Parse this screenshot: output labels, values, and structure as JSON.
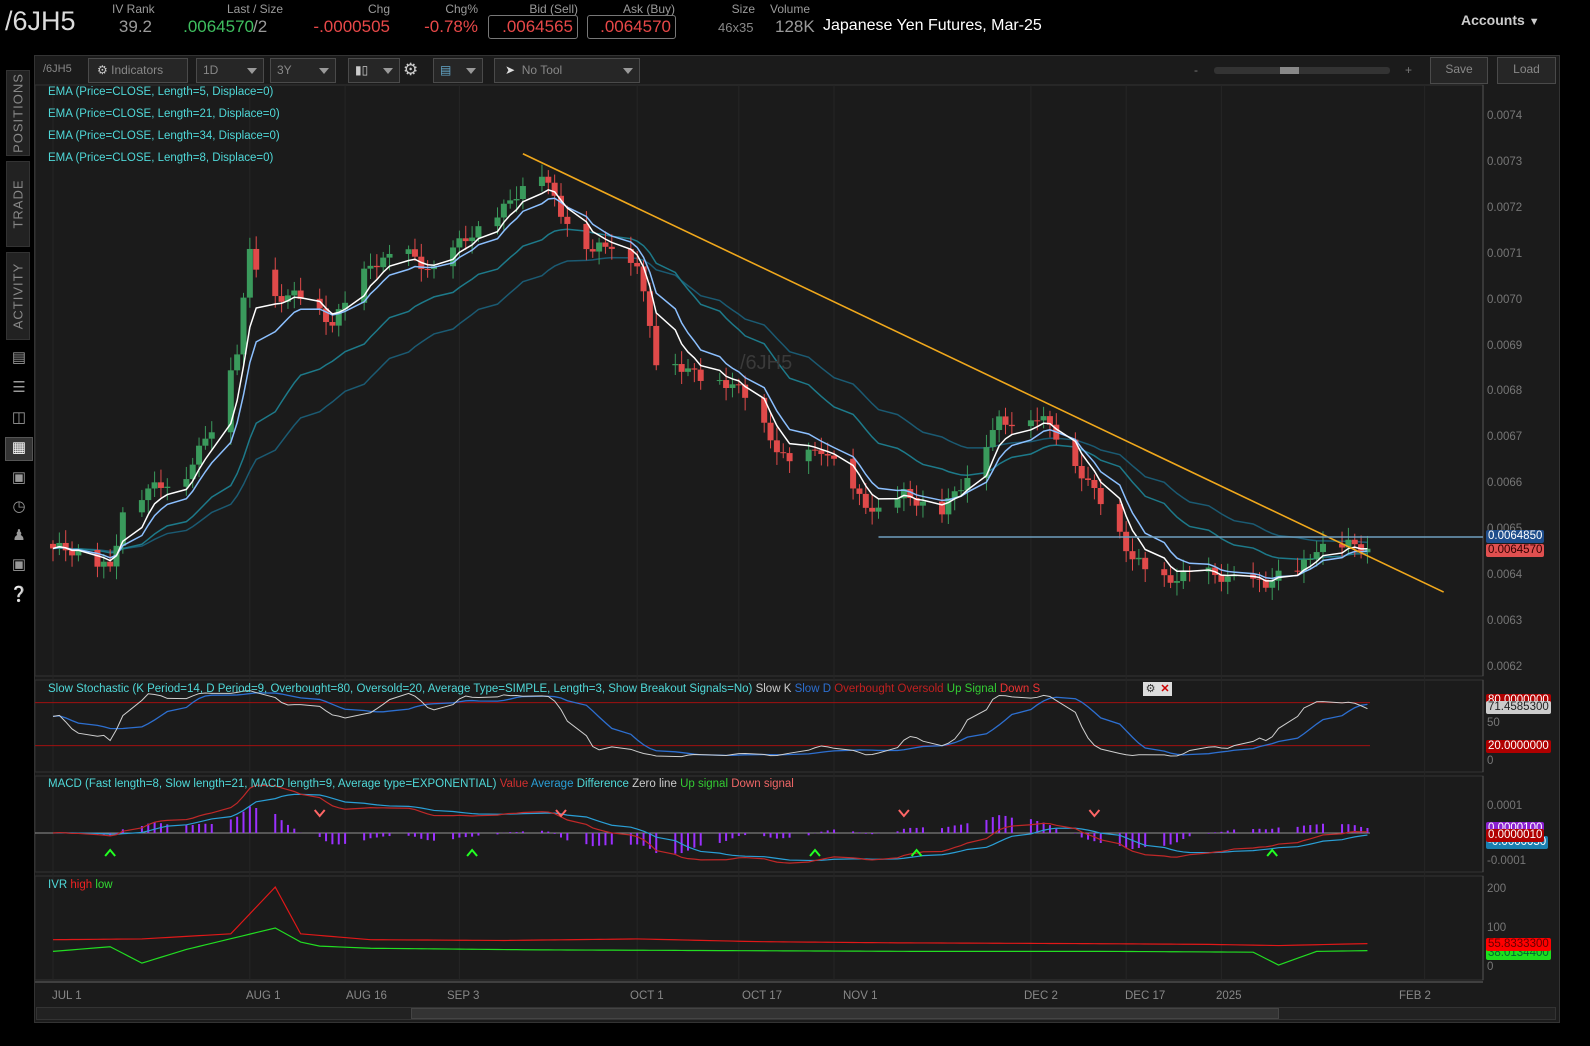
{
  "header": {
    "symbol": "/6JH5",
    "iv_rank_label": "IV Rank",
    "iv_rank": "39.2",
    "last_label": "Last / Size",
    "last": ".0064570",
    "last_size": "/2",
    "chg_label": "Chg",
    "chg": "-.0000505",
    "chgp_label": "Chg%",
    "chgp": "-0.78%",
    "bid_label": "Bid (Sell)",
    "bid": ".0064565",
    "ask_label": "Ask (Buy)",
    "ask": ".0064570",
    "size_label": "Size",
    "size": "46x35",
    "volume_label": "Volume",
    "volume": "128K",
    "description": "Japanese Yen Futures, Mar-25",
    "accounts": "Accounts"
  },
  "sidebar": {
    "tabs": [
      "POSITIONS",
      "TRADE",
      "ACTIVITY"
    ],
    "icons": [
      "news-icon",
      "watchlist-icon",
      "tv-icon",
      "chart-icon",
      "grid-icon",
      "history-icon",
      "community-icon",
      "calendar-icon",
      "help-icon"
    ]
  },
  "toolbar": {
    "symbol": "/6JH5",
    "indicators": "Indicators",
    "aggregation": "1D",
    "period": "3Y",
    "tool": "No Tool",
    "zoom_minus": "-",
    "zoom_plus": "+",
    "save": "Save",
    "load": "Load"
  },
  "colors": {
    "up": "#3a9a5c",
    "down": "#e04a4a",
    "ema5": "#ffffff",
    "ema8": "#8cc0ff",
    "ema21": "#1d7a8a",
    "ema34": "#1b5a72",
    "trend": "#f0a81c",
    "hline": "#6fa0c0"
  },
  "chart_data": {
    "type": "candlestick",
    "watermark": "/6JH5",
    "ylim": [
      0.0062,
      0.00745
    ],
    "y_ticks": [
      "0.0074",
      "0.0073",
      "0.0072",
      "0.0071",
      "0.0070",
      "0.0069",
      "0.0068",
      "0.0067",
      "0.0066",
      "0.0065",
      "0.0064",
      "0.0063",
      "0.0062"
    ],
    "x_ticks": [
      "JUL 1",
      "AUG 1",
      "AUG 16",
      "SEP 3",
      "OCT 1",
      "OCT 17",
      "NOV 1",
      "DEC 2",
      "DEC 17",
      "2025",
      "FEB 2"
    ],
    "legend": [
      "EMA (Price=CLOSE, Length=5, Displace=0)",
      "EMA (Price=CLOSE, Length=21, Displace=0)",
      "EMA (Price=CLOSE, Length=34, Displace=0)",
      "EMA (Price=CLOSE, Length=8, Displace=0)"
    ],
    "close_anchors": [
      [
        "2024-07-01",
        0.00646
      ],
      [
        "2024-07-10",
        0.006424
      ],
      [
        "2024-07-12",
        0.006544
      ],
      [
        "2024-07-22",
        0.00663
      ],
      [
        "2024-07-26",
        0.00672
      ],
      [
        "2024-07-30",
        0.00689
      ],
      [
        "2024-08-01",
        0.00711
      ],
      [
        "2024-08-05",
        0.00701
      ],
      [
        "2024-08-09",
        0.007
      ],
      [
        "2024-08-14",
        0.00696
      ],
      [
        "2024-08-20",
        0.00707
      ],
      [
        "2024-08-26",
        0.00711
      ],
      [
        "2024-08-30",
        0.00706
      ],
      [
        "2024-09-05",
        0.00715
      ],
      [
        "2024-09-10",
        0.0072
      ],
      [
        "2024-09-16",
        0.00728
      ],
      [
        "2024-09-19",
        0.0072
      ],
      [
        "2024-09-24",
        0.0071
      ],
      [
        "2024-09-27",
        0.00712
      ],
      [
        "2024-10-01",
        0.00709
      ],
      [
        "2024-10-04",
        0.00687
      ],
      [
        "2024-10-10",
        0.00684
      ],
      [
        "2024-10-16",
        0.00682
      ],
      [
        "2024-10-21",
        0.00672
      ],
      [
        "2024-10-25",
        0.00665
      ],
      [
        "2024-10-30",
        0.00667
      ],
      [
        "2024-11-04",
        0.00659
      ],
      [
        "2024-11-08",
        0.00654
      ],
      [
        "2024-11-12",
        0.00657
      ],
      [
        "2024-11-18",
        0.00655
      ],
      [
        "2024-11-22",
        0.00661
      ],
      [
        "2024-11-27",
        0.00674
      ],
      [
        "2024-12-02",
        0.00675
      ],
      [
        "2024-12-05",
        0.00672
      ],
      [
        "2024-12-10",
        0.00663
      ],
      [
        "2024-12-13",
        0.00657
      ],
      [
        "2024-12-18",
        0.00643
      ],
      [
        "2024-12-23",
        0.0064
      ],
      [
        "2024-12-30",
        0.0064
      ],
      [
        "2025-01-03",
        0.0064
      ],
      [
        "2025-01-08",
        0.00638
      ],
      [
        "2025-01-13",
        0.00641
      ],
      [
        "2025-01-16",
        0.00647
      ],
      [
        "2025-01-21",
        0.00646
      ],
      [
        "2025-01-24",
        0.006457
      ]
    ],
    "trendline": [
      [
        "2024-09-13",
        0.00732
      ],
      [
        "2025-02-05",
        0.006365
      ]
    ],
    "hline": {
      "from": "2024-11-08",
      "value": 0.006485
    },
    "price_tags": {
      "hline": "0.0064850",
      "last": "0.0064570"
    },
    "stochastic": {
      "legend": "Slow Stochastic (K Period=14, D Period=9, Overbought=80, Oversold=20, Average Type=SIMPLE, Length=3, Show Breakout Signals=No)",
      "items": [
        "Slow K",
        "Slow D",
        "Overbought",
        "Oversold",
        "Up Signal",
        "Down S"
      ],
      "overbought": 80,
      "oversold": 20,
      "ticks": [
        "50",
        "0"
      ],
      "tags": [
        "80.0000000",
        "71.4585300",
        "20.0000000"
      ]
    },
    "macd": {
      "legend": "MACD (Fast length=8, Slow length=21, MACD length=9, Average type=EXPONENTIAL)",
      "items": [
        "Value",
        "Average",
        "Difference",
        "Zero line",
        "Up signal",
        "Down signal"
      ],
      "ticks": [
        "0.0001",
        "-0.0001"
      ],
      "tags": [
        "0.0000100",
        "0.0000010",
        "-0.0000050"
      ],
      "up_signals": [
        "2024-07-10",
        "2024-09-05",
        "2024-10-29",
        "2024-11-14",
        "2025-01-09"
      ],
      "down_signals": [
        "2024-08-12",
        "2024-09-19",
        "2024-11-12",
        "2024-12-12"
      ]
    },
    "ivr": {
      "legend": "IVR",
      "items": [
        "high",
        "low"
      ],
      "ticks": [
        "200",
        "100",
        "0"
      ],
      "tags": [
        "55.8333300",
        "38.0134400"
      ],
      "high": [
        [
          "2024-07-01",
          70
        ],
        [
          "2024-07-15",
          72
        ],
        [
          "2024-07-29",
          85
        ],
        [
          "2024-08-05",
          205
        ],
        [
          "2024-08-09",
          85
        ],
        [
          "2024-08-20",
          70
        ],
        [
          "2024-09-10",
          68
        ],
        [
          "2024-10-01",
          72
        ],
        [
          "2024-10-20",
          65
        ],
        [
          "2024-11-10",
          62
        ],
        [
          "2024-12-10",
          60
        ],
        [
          "2024-12-30",
          58
        ],
        [
          "2025-01-10",
          55
        ],
        [
          "2025-01-24",
          60
        ]
      ],
      "low": [
        [
          "2024-07-01",
          40
        ],
        [
          "2024-07-10",
          52
        ],
        [
          "2024-07-15",
          10
        ],
        [
          "2024-07-22",
          45
        ],
        [
          "2024-08-05",
          100
        ],
        [
          "2024-08-10",
          55
        ],
        [
          "2024-08-20",
          48
        ],
        [
          "2024-09-15",
          44
        ],
        [
          "2024-10-15",
          42
        ],
        [
          "2024-11-15",
          40
        ],
        [
          "2024-12-15",
          40
        ],
        [
          "2025-01-06",
          38
        ],
        [
          "2025-01-10",
          5
        ],
        [
          "2025-01-16",
          40
        ],
        [
          "2025-01-24",
          42
        ]
      ]
    }
  }
}
